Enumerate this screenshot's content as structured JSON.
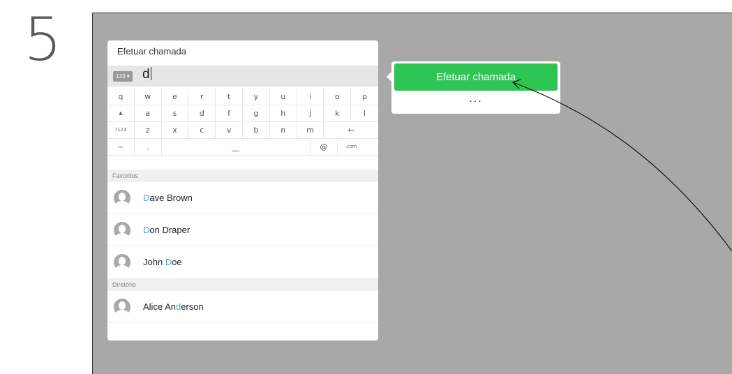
{
  "step_number": "5",
  "panel": {
    "title": "Efetuar chamada",
    "mode_label": "123 ▾",
    "typed_value": "d"
  },
  "keyboard": {
    "row1": [
      "q",
      "w",
      "e",
      "r",
      "t",
      "y",
      "u",
      "i",
      "o",
      "p"
    ],
    "row2": [
      "▲",
      "a",
      "s",
      "d",
      "f",
      "g",
      "h",
      "j",
      "k",
      "l"
    ],
    "row3": [
      "?123",
      "z",
      "x",
      "c",
      "v",
      "b",
      "n",
      "m",
      "←"
    ],
    "row4": [
      "~",
      ".",
      "__",
      "@",
      ".com"
    ]
  },
  "sections": {
    "favorites": "Favoritos",
    "directory": "Diretório"
  },
  "contacts": {
    "c1": {
      "pre": "",
      "match": "D",
      "post": "ave Brown"
    },
    "c2": {
      "pre": "",
      "match": "D",
      "post": "on Draper"
    },
    "c3": {
      "pre": "John ",
      "match": "D",
      "post": "oe"
    },
    "c4": {
      "pre": "Alice An",
      "match": "d",
      "post": "erson"
    }
  },
  "popup": {
    "call_label": "Efetuar chamada",
    "more_label": "..."
  },
  "colors": {
    "call_button": "#2dc654",
    "highlight": "#2fb8d7",
    "screen_bg": "#a8a8a8"
  }
}
